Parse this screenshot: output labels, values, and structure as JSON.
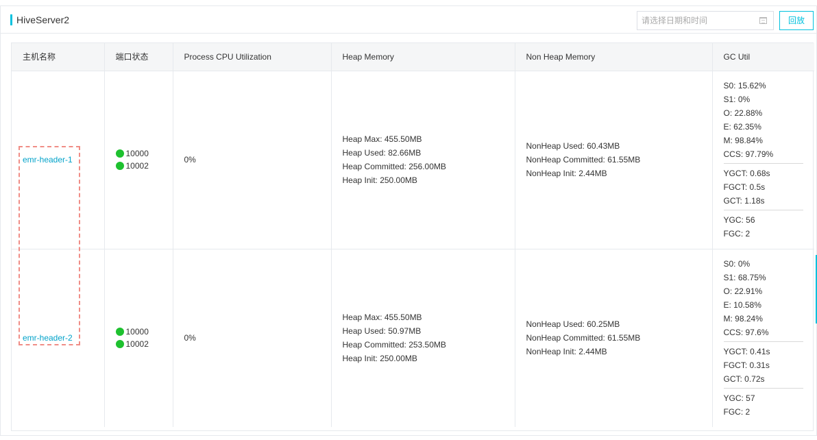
{
  "panel": {
    "title": "HiveServer2",
    "date_placeholder": "请选择日期和时间",
    "replay_label": "回放"
  },
  "table": {
    "headers": [
      "主机名称",
      "端口状态",
      "Process CPU Utilization",
      "Heap Memory",
      "Non Heap Memory",
      "GC Util"
    ],
    "rows": [
      {
        "host": "emr-header-1",
        "ports": [
          "10000",
          "10002"
        ],
        "cpu": "0%",
        "heap": [
          "Heap Max: 455.50MB",
          "Heap Used: 82.66MB",
          "Heap Committed: 256.00MB",
          "Heap Init: 250.00MB"
        ],
        "nonheap": [
          "NonHeap Used: 60.43MB",
          "NonHeap Committed: 61.55MB",
          "NonHeap Init: 2.44MB"
        ],
        "gc_util": [
          "S0: 15.62%",
          "S1: 0%",
          "O: 22.88%",
          "E: 62.35%",
          "M: 98.84%",
          "CCS: 97.79%"
        ],
        "gc_time": [
          "YGCT: 0.68s",
          "FGCT: 0.5s",
          "GCT: 1.18s"
        ],
        "gc_count": [
          "YGC: 56",
          "FGC: 2"
        ]
      },
      {
        "host": "emr-header-2",
        "ports": [
          "10000",
          "10002"
        ],
        "cpu": "0%",
        "heap": [
          "Heap Max: 455.50MB",
          "Heap Used: 50.97MB",
          "Heap Committed: 253.50MB",
          "Heap Init: 250.00MB"
        ],
        "nonheap": [
          "NonHeap Used: 60.25MB",
          "NonHeap Committed: 61.55MB",
          "NonHeap Init: 2.44MB"
        ],
        "gc_util": [
          "S0: 0%",
          "S1: 68.75%",
          "O: 22.91%",
          "E: 10.58%",
          "M: 98.24%",
          "CCS: 97.6%"
        ],
        "gc_time": [
          "YGCT: 0.41s",
          "FGCT: 0.31s",
          "GCT: 0.72s"
        ],
        "gc_count": [
          "YGC: 57",
          "FGC: 2"
        ]
      }
    ]
  },
  "colors": {
    "accent": "#00c1de",
    "link": "#00a2c9",
    "status_ok": "#1ec12f",
    "highlight_dash": "#f08d86"
  }
}
